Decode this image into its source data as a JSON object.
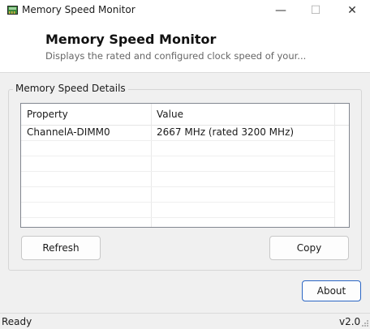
{
  "window": {
    "title": "Memory Speed Monitor",
    "minimize_glyph": "—",
    "maximize_glyph": "☐",
    "close_glyph": "✕"
  },
  "header": {
    "title": "Memory Speed Monitor",
    "subtitle": "Displays the rated and configured clock speed of your..."
  },
  "details": {
    "group_label": "Memory Speed Details",
    "columns": [
      "Property",
      "Value"
    ],
    "rows": [
      {
        "property": "ChannelA-DIMM0",
        "value": "2667 MHz (rated 3200 MHz)"
      }
    ]
  },
  "buttons": {
    "refresh": "Refresh",
    "copy": "Copy",
    "about": "About"
  },
  "status": {
    "left": "Ready",
    "right": "v2.0"
  },
  "colors": {
    "accent_border": "#2b66c4",
    "list_border": "#828790"
  },
  "icons": {
    "app": "memory-chip-icon"
  }
}
